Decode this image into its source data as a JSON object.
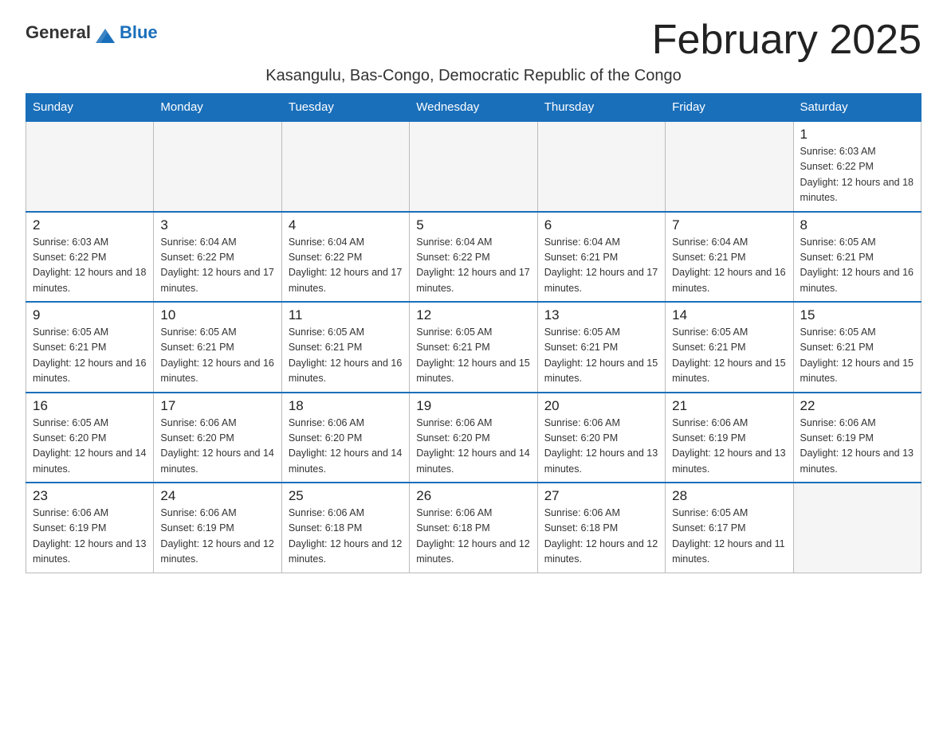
{
  "header": {
    "logo_general": "General",
    "logo_blue": "Blue",
    "month_title": "February 2025",
    "location": "Kasangulu, Bas-Congo, Democratic Republic of the Congo"
  },
  "days_of_week": [
    "Sunday",
    "Monday",
    "Tuesday",
    "Wednesday",
    "Thursday",
    "Friday",
    "Saturday"
  ],
  "weeks": [
    [
      {
        "day": "",
        "empty": true
      },
      {
        "day": "",
        "empty": true
      },
      {
        "day": "",
        "empty": true
      },
      {
        "day": "",
        "empty": true
      },
      {
        "day": "",
        "empty": true
      },
      {
        "day": "",
        "empty": true
      },
      {
        "day": "1",
        "sunrise": "6:03 AM",
        "sunset": "6:22 PM",
        "daylight": "12 hours and 18 minutes."
      }
    ],
    [
      {
        "day": "2",
        "sunrise": "6:03 AM",
        "sunset": "6:22 PM",
        "daylight": "12 hours and 18 minutes."
      },
      {
        "day": "3",
        "sunrise": "6:04 AM",
        "sunset": "6:22 PM",
        "daylight": "12 hours and 17 minutes."
      },
      {
        "day": "4",
        "sunrise": "6:04 AM",
        "sunset": "6:22 PM",
        "daylight": "12 hours and 17 minutes."
      },
      {
        "day": "5",
        "sunrise": "6:04 AM",
        "sunset": "6:22 PM",
        "daylight": "12 hours and 17 minutes."
      },
      {
        "day": "6",
        "sunrise": "6:04 AM",
        "sunset": "6:21 PM",
        "daylight": "12 hours and 17 minutes."
      },
      {
        "day": "7",
        "sunrise": "6:04 AM",
        "sunset": "6:21 PM",
        "daylight": "12 hours and 16 minutes."
      },
      {
        "day": "8",
        "sunrise": "6:05 AM",
        "sunset": "6:21 PM",
        "daylight": "12 hours and 16 minutes."
      }
    ],
    [
      {
        "day": "9",
        "sunrise": "6:05 AM",
        "sunset": "6:21 PM",
        "daylight": "12 hours and 16 minutes."
      },
      {
        "day": "10",
        "sunrise": "6:05 AM",
        "sunset": "6:21 PM",
        "daylight": "12 hours and 16 minutes."
      },
      {
        "day": "11",
        "sunrise": "6:05 AM",
        "sunset": "6:21 PM",
        "daylight": "12 hours and 16 minutes."
      },
      {
        "day": "12",
        "sunrise": "6:05 AM",
        "sunset": "6:21 PM",
        "daylight": "12 hours and 15 minutes."
      },
      {
        "day": "13",
        "sunrise": "6:05 AM",
        "sunset": "6:21 PM",
        "daylight": "12 hours and 15 minutes."
      },
      {
        "day": "14",
        "sunrise": "6:05 AM",
        "sunset": "6:21 PM",
        "daylight": "12 hours and 15 minutes."
      },
      {
        "day": "15",
        "sunrise": "6:05 AM",
        "sunset": "6:21 PM",
        "daylight": "12 hours and 15 minutes."
      }
    ],
    [
      {
        "day": "16",
        "sunrise": "6:05 AM",
        "sunset": "6:20 PM",
        "daylight": "12 hours and 14 minutes."
      },
      {
        "day": "17",
        "sunrise": "6:06 AM",
        "sunset": "6:20 PM",
        "daylight": "12 hours and 14 minutes."
      },
      {
        "day": "18",
        "sunrise": "6:06 AM",
        "sunset": "6:20 PM",
        "daylight": "12 hours and 14 minutes."
      },
      {
        "day": "19",
        "sunrise": "6:06 AM",
        "sunset": "6:20 PM",
        "daylight": "12 hours and 14 minutes."
      },
      {
        "day": "20",
        "sunrise": "6:06 AM",
        "sunset": "6:20 PM",
        "daylight": "12 hours and 13 minutes."
      },
      {
        "day": "21",
        "sunrise": "6:06 AM",
        "sunset": "6:19 PM",
        "daylight": "12 hours and 13 minutes."
      },
      {
        "day": "22",
        "sunrise": "6:06 AM",
        "sunset": "6:19 PM",
        "daylight": "12 hours and 13 minutes."
      }
    ],
    [
      {
        "day": "23",
        "sunrise": "6:06 AM",
        "sunset": "6:19 PM",
        "daylight": "12 hours and 13 minutes."
      },
      {
        "day": "24",
        "sunrise": "6:06 AM",
        "sunset": "6:19 PM",
        "daylight": "12 hours and 12 minutes."
      },
      {
        "day": "25",
        "sunrise": "6:06 AM",
        "sunset": "6:18 PM",
        "daylight": "12 hours and 12 minutes."
      },
      {
        "day": "26",
        "sunrise": "6:06 AM",
        "sunset": "6:18 PM",
        "daylight": "12 hours and 12 minutes."
      },
      {
        "day": "27",
        "sunrise": "6:06 AM",
        "sunset": "6:18 PM",
        "daylight": "12 hours and 12 minutes."
      },
      {
        "day": "28",
        "sunrise": "6:05 AM",
        "sunset": "6:17 PM",
        "daylight": "12 hours and 11 minutes."
      },
      {
        "day": "",
        "empty": true
      }
    ]
  ]
}
